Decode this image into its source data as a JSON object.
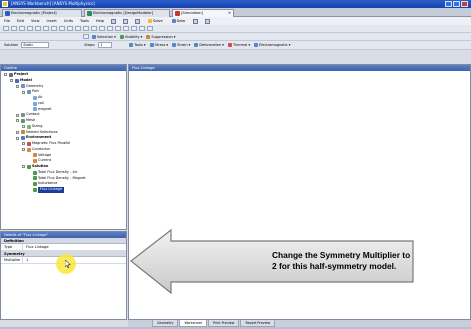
{
  "window": {
    "title": "[ANSYS Workbench] [ANSYS Multiphysics]"
  },
  "doc_tabs": [
    {
      "label": "Electromagnetic [Project]",
      "color": "#2b5bbf",
      "active": false
    },
    {
      "label": "Electromagnetic [DesignModeler]",
      "color": "#2e8b57",
      "active": false
    },
    {
      "label": "[Simulation]",
      "color": "#c0392b",
      "active": true
    }
  ],
  "menu": {
    "items": [
      "File",
      "Edit",
      "View",
      "Insert",
      "Units",
      "Tools",
      "Help"
    ],
    "buttons": [
      "Solve",
      "Data"
    ]
  },
  "toolbar2": {
    "selection_label": "Selection",
    "visibility_label": "Visibility",
    "suppression_label": "Suppression"
  },
  "toolbar3": {
    "solution_label": "Solution",
    "solution_value": "Static",
    "steps_label": "Steps:",
    "steps_value": "1",
    "tools": [
      "Tools",
      "Stress",
      "Strain",
      "Deformation",
      "Thermal",
      "Electromagnetic"
    ]
  },
  "outline": {
    "header": "Outline",
    "tree": [
      {
        "label": "Project",
        "depth": 0,
        "color": "#6a6a6a",
        "bold": true
      },
      {
        "label": "Model",
        "depth": 1,
        "color": "#3b6fb6",
        "bold": true
      },
      {
        "label": "Geometry",
        "depth": 2,
        "color": "#6a8fc9"
      },
      {
        "label": "Part",
        "depth": 3,
        "color": "#6a8fc9"
      },
      {
        "label": "Air",
        "depth": 4,
        "color": "#7ba7e0"
      },
      {
        "label": "coil",
        "depth": 4,
        "color": "#7ba7e0"
      },
      {
        "label": "magnet",
        "depth": 4,
        "color": "#7ba7e0"
      },
      {
        "label": "Contact",
        "depth": 2,
        "color": "#8a8a8a"
      },
      {
        "label": "Mesh",
        "depth": 2,
        "color": "#5a9a5a"
      },
      {
        "label": "Sizing",
        "depth": 3,
        "color": "#7fb37f"
      },
      {
        "label": "Named Selections",
        "depth": 2,
        "color": "#c08a3a"
      },
      {
        "label": "Environment",
        "depth": 2,
        "color": "#4a7bd0",
        "bold": true
      },
      {
        "label": "Magnetic Flux Parallel",
        "depth": 3,
        "color": "#d04a4a"
      },
      {
        "label": "Conductor",
        "depth": 3,
        "color": "#d08a3a"
      },
      {
        "label": "Voltage",
        "depth": 4,
        "color": "#d08a3a"
      },
      {
        "label": "Current",
        "depth": 4,
        "color": "#d08a3a"
      },
      {
        "label": "Solution",
        "depth": 3,
        "color": "#4a9a4a",
        "bold": true
      },
      {
        "label": "Total Flux Density - Air",
        "depth": 4,
        "color": "#4a9a4a"
      },
      {
        "label": "Total Flux Density - Magnet",
        "depth": 4,
        "color": "#4a9a4a"
      },
      {
        "label": "Inductance",
        "depth": 4,
        "color": "#4a9a4a"
      },
      {
        "label": "Flux Linkage",
        "depth": 4,
        "color": "#4a9a4a",
        "selected": true
      }
    ]
  },
  "details": {
    "header": "Details of \"Flux Linkage\"",
    "sections": [
      {
        "title": "Definition",
        "rows": [
          {
            "key": "Type",
            "value": "Flux Linkage"
          }
        ]
      },
      {
        "title": "Symmetry",
        "rows": [
          {
            "key": "Multiplier",
            "value": "1"
          }
        ]
      }
    ]
  },
  "graphics": {
    "header": "Flux Linkage"
  },
  "callout": {
    "text": "Change the Symmetry Multiplier to 2 for this half-symmetry model."
  },
  "bottom_tabs": [
    {
      "label": "Geometry",
      "active": false
    },
    {
      "label": "Worksheet",
      "active": true
    },
    {
      "label": "Print Preview",
      "active": false
    },
    {
      "label": "Report Preview",
      "active": false
    }
  ]
}
